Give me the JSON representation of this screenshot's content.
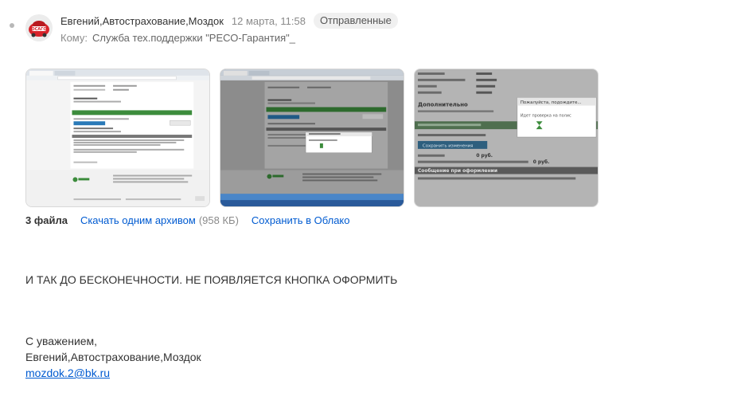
{
  "message": {
    "sender": "Евгений,Автострахование,Моздок",
    "date": "12 марта, 11:58",
    "folder": "Отправленные",
    "to_label": "Кому:",
    "to_name": "Служба тех.поддержки \"РЕСО-Гарантия\"_",
    "avatar_text": "ОСАГО"
  },
  "attachments": {
    "count_label": "3 файла",
    "download_label": "Скачать одним архивом",
    "archive_size": "(958 КБ)",
    "cloud_label": "Сохранить в Облако"
  },
  "body": {
    "text": "И ТАК ДО БЕСКОНЕЧНОСТИ. НЕ ПОЯВЛЯЕТСЯ КНОПКА ОФОРМИТЬ",
    "signature_greeting": "С уважением,",
    "signature_name": "Евгений,Автострахование,Моздок",
    "signature_email": "mozdok.2@bk.ru"
  },
  "thumbnail3": {
    "section": "Дополнительно",
    "popup_title": "Пожалуйста, подождите...",
    "popup_text": "Идет проверка на полис",
    "button": "Сохранить изменения",
    "price1": "0 руб.",
    "price2": "0 руб.",
    "error_header": "Сообщение при оформлении"
  },
  "colors": {
    "link": "#005bd1",
    "avatar_red": "#d8242b",
    "reso_green": "#3c8c3c"
  }
}
